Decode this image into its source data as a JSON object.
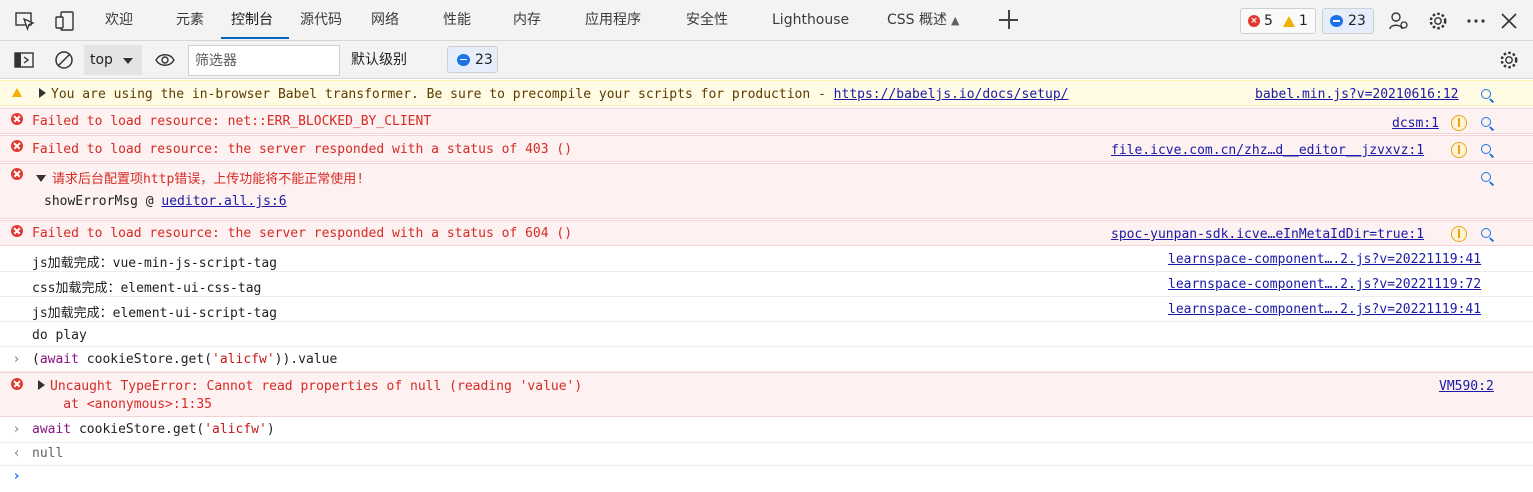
{
  "tabs": {
    "items": [
      {
        "label": "欢迎"
      },
      {
        "label": "元素"
      },
      {
        "label": "控制台"
      },
      {
        "label": "源代码"
      },
      {
        "label": "网络"
      },
      {
        "label": "性能"
      },
      {
        "label": "内存"
      },
      {
        "label": "应用程序"
      },
      {
        "label": "安全性"
      },
      {
        "label": "Lighthouse"
      },
      {
        "label": "CSS 概述"
      }
    ],
    "active": "控制台",
    "error_count": "5",
    "warning_count": "1",
    "message_count": "23"
  },
  "toolbar": {
    "context": "top",
    "filter_placeholder": "筛选器",
    "level": "默认级别",
    "message_count": "23"
  },
  "console": {
    "warn1": {
      "prefix": "You are using the in-browser Babel transformer. Be sure to precompile your scripts for production - ",
      "link": "https://babeljs.io/docs/setup/",
      "source": "babel.min.js?v=20210616:12"
    },
    "err1": {
      "text": "Failed to load resource: net::ERR_BLOCKED_BY_CLIENT",
      "source": "dcsm:1"
    },
    "err2": {
      "text": "Failed to load resource: the server responded with a status of 403 ()",
      "source": "file.icve.com.cn/zhz…d__editor__jzvxvz:1"
    },
    "err3": {
      "text": "请求后台配置项http错误，上传功能将不能正常使用!",
      "stack_prefix": "showErrorMsg @ ",
      "stack_link": "ueditor.all.js:6"
    },
    "err4": {
      "text": "Failed to load resource: the server responded with a status of 604 ()",
      "source": "spoc-yunpan-sdk.icve…eInMetaIdDir=true:1"
    },
    "log1": {
      "text": "js加载完成：vue-min-js-script-tag",
      "source": "learnspace-component….2.js?v=20221119:41"
    },
    "log2": {
      "text": "css加载完成：element-ui-css-tag",
      "source": "learnspace-component….2.js?v=20221119:72"
    },
    "log3": {
      "text": "js加载完成：element-ui-script-tag",
      "source": "learnspace-component….2.js?v=20221119:41"
    },
    "log4": {
      "text": "do play"
    },
    "input1": {
      "kw": "await",
      "pre": " cookieStore.get(",
      "str": "'alicfw'",
      "post": ")).value",
      "open": "("
    },
    "err5": {
      "line1": "Uncaught TypeError: Cannot read properties of null (reading 'value')",
      "line2": "    at <anonymous>:1:35",
      "source": "VM590:2"
    },
    "input2": {
      "kw": "await",
      "pre": " cookieStore.get(",
      "str": "'alicfw'",
      "post": ")"
    },
    "result2": {
      "text": "null"
    }
  },
  "colors": {
    "accent": "#0067c0",
    "error": "#e0392f",
    "warning": "#f2b100",
    "error_bg": "#fdf1f1",
    "warning_bg": "#fffbe5"
  },
  "icons": {
    "inspect": "inspect-element-icon",
    "device": "device-emulation-icon",
    "sidebar": "show-sidebar-icon",
    "clear": "clear-console-icon",
    "live": "live-expression-eye-icon",
    "settings": "gear-icon",
    "more": "more-options-icon",
    "close": "close-icon",
    "profile": "customize-icon"
  }
}
